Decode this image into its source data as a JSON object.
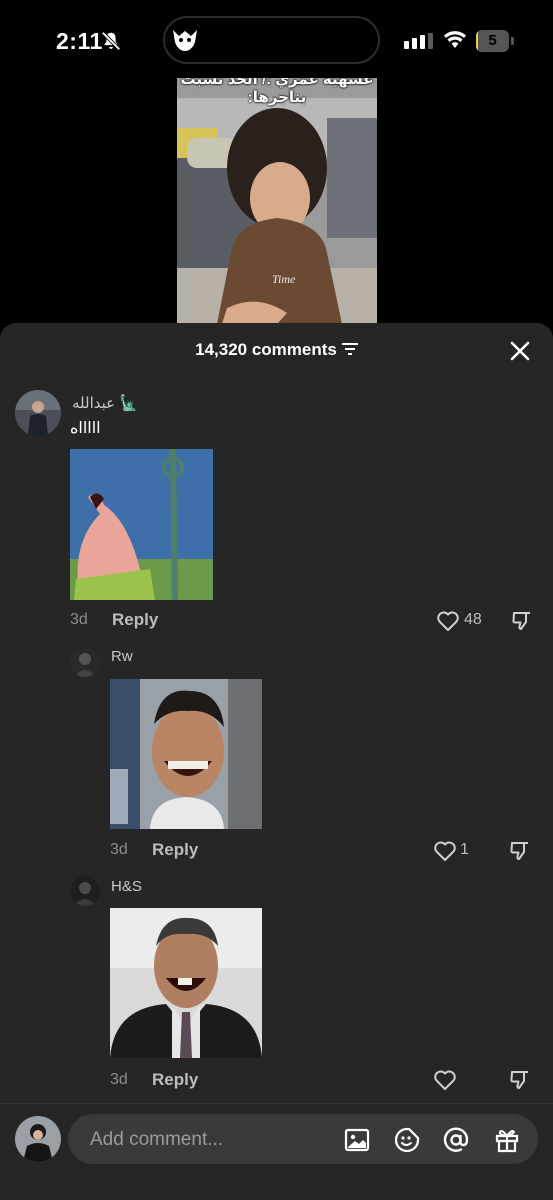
{
  "status_bar": {
    "time": "2:11",
    "battery": 5,
    "battery_text": "5"
  },
  "video": {
    "caption_line1": "عسهبه عمري :/ الحد نسبت",
    "caption_line2": "بناجرها:"
  },
  "comments_sheet": {
    "title": "14,320 comments",
    "comments": [
      {
        "username": "عبدالله 🗽",
        "text": "اااااه",
        "date": "3d",
        "reply_label": "Reply",
        "likes": "48"
      },
      {
        "username": "Rw",
        "text": "",
        "date": "3d",
        "reply_label": "Reply",
        "likes": "1"
      },
      {
        "username": "H&S",
        "text": "",
        "date": "3d",
        "reply_label": "Reply",
        "likes": ""
      }
    ]
  },
  "composer": {
    "placeholder": "Add comment..."
  },
  "colors": {
    "sheet_bg": "#262626",
    "input_bg": "#3a3a3a",
    "battery_accent": "#f2c94c"
  },
  "icons": [
    "mute-bell-icon",
    "app-activity-icon",
    "signal-icon",
    "wifi-icon",
    "battery-icon",
    "filter-icon",
    "close-icon",
    "heart-icon",
    "dislike-icon",
    "image-icon",
    "emoji-icon",
    "mention-icon",
    "gift-icon"
  ]
}
